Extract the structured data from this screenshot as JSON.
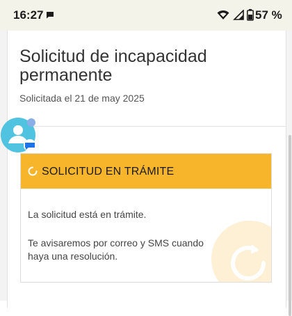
{
  "status_bar": {
    "time": "16:27",
    "battery": "57 %",
    "icons": [
      "message-icon",
      "wifi-icon",
      "signal-icon",
      "battery-icon"
    ]
  },
  "request": {
    "title": "Solicitud de incapacidad permanente",
    "subtitle": "Solicitada el 21 de may 2025"
  },
  "status": {
    "label": "SOLICITUD EN TRÁMITE",
    "message": "La solicitud está en trámite.",
    "notice": "Te avisaremos por correo y SMS cuando haya una resolución.",
    "color": "#f7b52c"
  },
  "chat_head": {
    "icon": "contact-avatar-icon",
    "badge": "messages-badge-icon",
    "color": "#4fc3e0"
  }
}
